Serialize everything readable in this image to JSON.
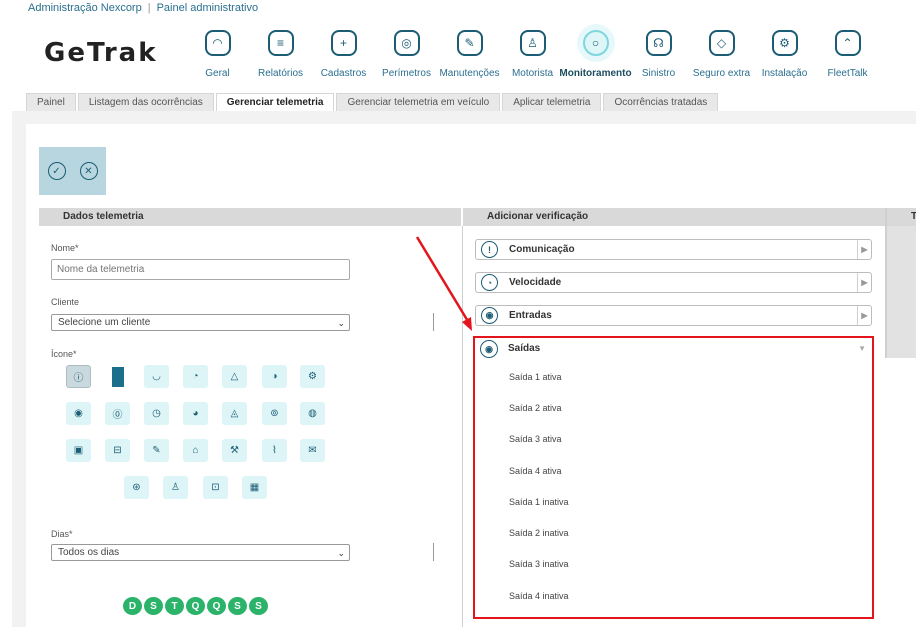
{
  "breadcrumb": {
    "org": "Administração Nexcorp",
    "page": "Painel administrativo"
  },
  "logo": {
    "text": "GeTrak"
  },
  "nav": [
    {
      "label": "Geral",
      "icon": "gauge-icon",
      "glyph": "◠"
    },
    {
      "label": "Relatórios",
      "icon": "report-icon",
      "glyph": "≡"
    },
    {
      "label": "Cadastros",
      "icon": "folder-add-icon",
      "glyph": "+"
    },
    {
      "label": "Perímetros",
      "icon": "perimeter-icon",
      "glyph": "◎"
    },
    {
      "label": "Manutenções",
      "icon": "wrench-icon",
      "glyph": "✎"
    },
    {
      "label": "Motorista",
      "icon": "driver-icon",
      "glyph": "♙"
    },
    {
      "label": "Monitoramento",
      "icon": "monitoring-icon",
      "glyph": "○",
      "active": true
    },
    {
      "label": "Sinistro",
      "icon": "alarm-icon",
      "glyph": "☊"
    },
    {
      "label": "Seguro extra",
      "icon": "insurance-icon",
      "glyph": "◇"
    },
    {
      "label": "Instalação",
      "icon": "installation-icon",
      "glyph": "⚙"
    },
    {
      "label": "FleetTalk",
      "icon": "fleettalk-icon",
      "glyph": "⌃"
    }
  ],
  "tabs": [
    {
      "label": "Painel"
    },
    {
      "label": "Listagem das ocorrências"
    },
    {
      "label": "Gerenciar telemetria",
      "active": true
    },
    {
      "label": "Gerenciar telemetria em veículo"
    },
    {
      "label": "Aplicar telemetria"
    },
    {
      "label": "Ocorrências tratadas"
    }
  ],
  "left": {
    "title": "Dados telemetria",
    "name_label": "Nome*",
    "name_placeholder": "Nome da telemetria",
    "client_label": "Cliente",
    "client_value": "Selecione um cliente",
    "icon_label": "Ícone*",
    "days_label": "Dias*",
    "days_value": "Todos os dias",
    "days": [
      "D",
      "S",
      "T",
      "Q",
      "Q",
      "S",
      "S"
    ]
  },
  "right": {
    "title": "Adicionar verificação",
    "far_title": "T",
    "sections": [
      {
        "label": "Comunicação",
        "icon": "alert-circle-icon",
        "glyph": "!"
      },
      {
        "label": "Velocidade",
        "icon": "speedometer-icon",
        "glyph": "◔"
      },
      {
        "label": "Entradas",
        "icon": "signal-in-icon",
        "glyph": "◉"
      }
    ],
    "open_section": {
      "label": "Saídas",
      "icon": "signal-out-icon",
      "glyph": "◉",
      "options": [
        "Saída 1 ativa",
        "Saída 2 ativa",
        "Saída 3 ativa",
        "Saída 4 ativa",
        "Saída 1 inativa",
        "Saída 2 inativa",
        "Saída 3 inativa",
        "Saída 4 inativa"
      ]
    }
  },
  "colors": {
    "accent": "#1c5c74",
    "highlight": "#e3141b",
    "day_green": "#2bb36a",
    "icon_bg": "#ddf5f7"
  }
}
